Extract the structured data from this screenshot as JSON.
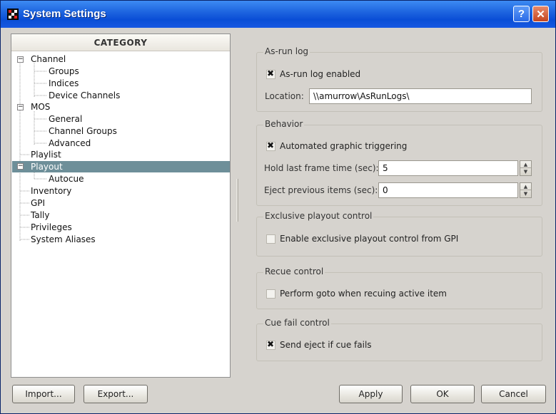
{
  "window": {
    "title": "System Settings",
    "help_label": "?",
    "close_label": "✕"
  },
  "category": {
    "header": "CATEGORY",
    "items": [
      {
        "label": "Channel",
        "level": 0,
        "expander": "−"
      },
      {
        "label": "Groups",
        "level": 1
      },
      {
        "label": "Indices",
        "level": 1
      },
      {
        "label": "Device Channels",
        "level": 1
      },
      {
        "label": "MOS",
        "level": 0,
        "expander": "−"
      },
      {
        "label": "General",
        "level": 1
      },
      {
        "label": "Channel Groups",
        "level": 1
      },
      {
        "label": "Advanced",
        "level": 1
      },
      {
        "label": "Playlist",
        "level": 0
      },
      {
        "label": "Playout",
        "level": 0,
        "expander": "−",
        "selected": true
      },
      {
        "label": "Autocue",
        "level": 1
      },
      {
        "label": "Inventory",
        "level": 0
      },
      {
        "label": "GPI",
        "level": 0
      },
      {
        "label": "Tally",
        "level": 0
      },
      {
        "label": "Privileges",
        "level": 0
      },
      {
        "label": "System Aliases",
        "level": 0
      }
    ]
  },
  "asrun": {
    "title": "As-run log",
    "enabled_label": "As-run log enabled",
    "enabled": true,
    "location_label": "Location:",
    "location_value": "\\\\amurrow\\AsRunLogs\\"
  },
  "behavior": {
    "title": "Behavior",
    "auto_trigger_label": "Automated graphic triggering",
    "auto_trigger": true,
    "hold_label": "Hold last frame time (sec):",
    "hold_value": "5",
    "eject_label": "Eject previous items (sec):",
    "eject_value": "0"
  },
  "exclusive": {
    "title": "Exclusive playout control",
    "enable_label": "Enable exclusive playout control from GPI",
    "enabled": false
  },
  "recue": {
    "title": "Recue control",
    "goto_label": "Perform goto when recuing active item",
    "enabled": false
  },
  "cuefail": {
    "title": "Cue fail control",
    "send_eject_label": "Send eject if cue fails",
    "enabled": true
  },
  "buttons": {
    "import": "Import...",
    "export": "Export...",
    "apply": "Apply",
    "ok": "OK",
    "cancel": "Cancel"
  },
  "icons": {
    "app": "app-logo-icon",
    "help": "help-icon",
    "close": "close-icon",
    "spin_up": "chevron-up-icon",
    "spin_down": "chevron-down-icon"
  },
  "colors": {
    "titlebar": "#1f66e0",
    "selection": "#6e8f99",
    "window_bg": "#d6d3ce"
  }
}
